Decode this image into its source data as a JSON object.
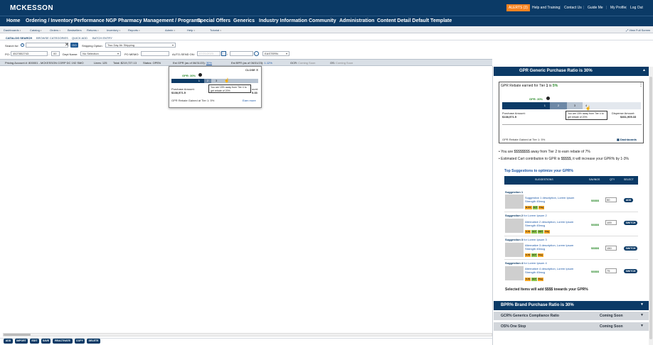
{
  "top": {
    "logo": "MCKESSON",
    "alerts": "ALERTS (3)",
    "links": [
      "Help and Training",
      "Contact Us",
      "Guide Me",
      "My Profile",
      "Log Out"
    ]
  },
  "nav": [
    "Home",
    "Ordering / Inventory",
    "Performance NGP",
    "Pharmacy Management / Programs",
    "Special Offers",
    "Generics",
    "Industry Information",
    "Community",
    "Administration",
    "Content Detail Default Template"
  ],
  "subnav": [
    "Dashboards",
    "Catalog",
    "Orders",
    "Bestsellers",
    "Returns",
    "Inventory",
    "Reports",
    "Admin",
    "Help",
    "Tutorial"
  ],
  "view_full_screen": "View Full Screen",
  "tabs": [
    "CATALOG SEARCH",
    "BROWSE CATEGORIES",
    "QUICK ADD",
    "BATCH ENTRY"
  ],
  "search": {
    "label": "Search for:",
    "go": "GO",
    "shipping_label": "Shipping Option:",
    "shipping_value": "Two Day Air Shipping"
  },
  "order": {
    "po_label": "PO:",
    "po_value": "4527852743",
    "dept_num": "00",
    "dept_label": "Dept Name:",
    "dept_value": "No Selection",
    "memo_label": "PO MEMO:",
    "auto_label": "AUTO-SEND ON:",
    "auto_date": "07/21/2023",
    "tz": "EASTERN"
  },
  "account": {
    "pricing": "Pricing Account #:",
    "pricing_value": "800001 - MCKESSON CORP DC 192 SMO",
    "lines": "Lines:",
    "lines_value": "125",
    "total": "Total:",
    "total_value": "$219,727.13",
    "status": "Status:",
    "status_value": "OPEN",
    "est_gpr": "Est GPR (as of 06/31/23):",
    "est_gpr_value": "30%",
    "est_bpr": "Est BPR (as of 06/31/23):",
    "est_bpr_value": "1.12%",
    "gcr": "GCR:",
    "gcr_value": "Coming Soon",
    "os": "OS:",
    "os_value": "Coming Soon"
  },
  "popup": {
    "close": "CLOSE",
    "gpr": "GPR: 30%",
    "tiers": [
      "1",
      "2",
      "3"
    ],
    "tooltip": "You are 15% away from Tier 4 to get rebate of 20%",
    "purchase_label": "Purchase Amount:",
    "purchase_value": "$138,571.5",
    "partial_amount": "ount:",
    "partial_value": "5.33",
    "rebate": "GPR Rebate Gained at Tier 1: 5%",
    "earn_more": "Earn more"
  },
  "panel": {
    "gpr_header": "GPR  Generic Purchase Ratio is 30%",
    "rebate_title_pre": "GPR Rebate earned for Tier ",
    "rebate_tier": "1",
    "rebate_title_mid": " is ",
    "rebate_pct": "5%",
    "gpr_label": "GPR: 30%",
    "tiers": [
      "1",
      "2",
      "3",
      "4"
    ],
    "tooltip": "You are 15% away from Tier 4 to get rebate of 20%",
    "purchase_label": "Purchase Amount:",
    "purchase_value": "$138,571.5",
    "dispense_label": "Dispense Amount:",
    "dispense_value": "$461,905.33",
    "rebate_gained": "GPR Rebate Gained at Tier 1: 5%",
    "dashboards": "Dashboards",
    "bullet1": "You are $$$$$$$$ away from Tier 2 to earn rebate of 7%",
    "bullet2": "Estimated Cart contribution to GPR is $$$$$, it will increase your GPR% by 1-3%",
    "top_title": "Top Suggestions to optimize your GPR%",
    "cols": [
      "SUGGESTIONS",
      "SAVINGS",
      "QTY",
      "SELECT"
    ],
    "suggestions": [
      {
        "title": "Suggestion 1",
        "sub": "",
        "desc": "Suggestion 1 description, Lorem Ipsum Strength 45mcg",
        "tags": [
          "B-OS",
          "ALT",
          "Flag"
        ],
        "savings": "$$$$$",
        "qty": "50",
        "action": "ADD"
      },
      {
        "title": "Suggestion 2",
        "sub": "for Lorem Ipsum 2",
        "desc": "Alternative 2 description, Lorem Ipsum Strength 45mcg",
        "tags": [
          "C-IS",
          "ALT",
          "HOT",
          "Flag"
        ],
        "savings": "$$$$$",
        "qty": "100",
        "action": "SWITCH"
      },
      {
        "title": "Suggestion 3",
        "sub": "for Lorem Ipsum 3",
        "desc": "Alternative 3 description, Lorem Ipsum Strength 45mcg",
        "tags": [
          "C-IS",
          "ALT",
          "Flag"
        ],
        "savings": "$$$$$",
        "qty": "150",
        "action": "SWITCH"
      },
      {
        "title": "Suggestion 4",
        "sub": "for Lorem Ipsum 4",
        "desc": "Alternative 4 description, Lorem Ipsum Strength 45mcg",
        "tags": [
          "C-IS",
          "ALT",
          "Flag"
        ],
        "savings": "$$$$$",
        "qty": "75",
        "action": "SWITCH"
      }
    ],
    "selected": "Selected Items will add $$$$ towards your GPR%",
    "bpr_header": "BPR%  Brand Purchase Ratio is 30%",
    "gcr_header": "GCR% Generics Compliance Ratio",
    "gcr_status": "Coming Soon",
    "os_header": "OS%  One Stop",
    "os_status": "Coming Soon"
  },
  "bottom_buttons": [
    "ADD",
    "IMPORT",
    "EDIT",
    "SAVE",
    "REACTIVATE",
    "COPY",
    "DELETE"
  ],
  "colors": {
    "navy": "#0b3a66",
    "alert": "#f58220",
    "link": "#1a56a6"
  }
}
